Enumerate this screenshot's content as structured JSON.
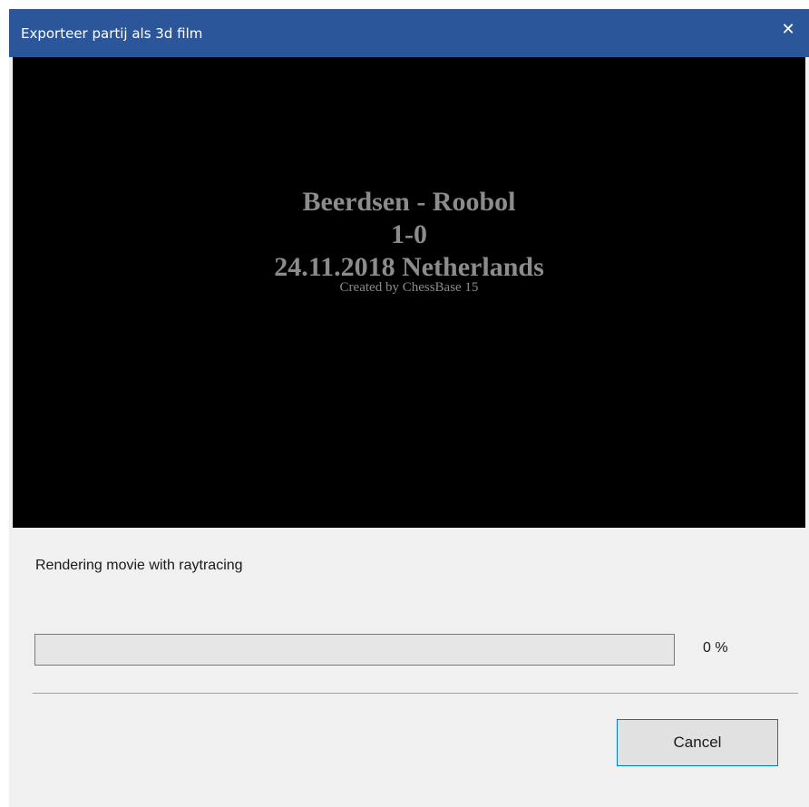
{
  "window": {
    "title": "Exporteer partij als 3d film",
    "close_glyph": "✕",
    "close_icon": "close-icon"
  },
  "preview": {
    "players": "Beerdsen - Roobol",
    "result": "1-0",
    "date_place": "24.11.2018 Netherlands",
    "credit": "Created by ChessBase 15"
  },
  "status": {
    "message": "Rendering movie with raytracing",
    "progress_fraction": 0,
    "percent_label": "0 %"
  },
  "buttons": {
    "cancel_label": "Cancel"
  },
  "colors": {
    "titlebar": "#2b579a",
    "accent_border": "#0078d7"
  }
}
